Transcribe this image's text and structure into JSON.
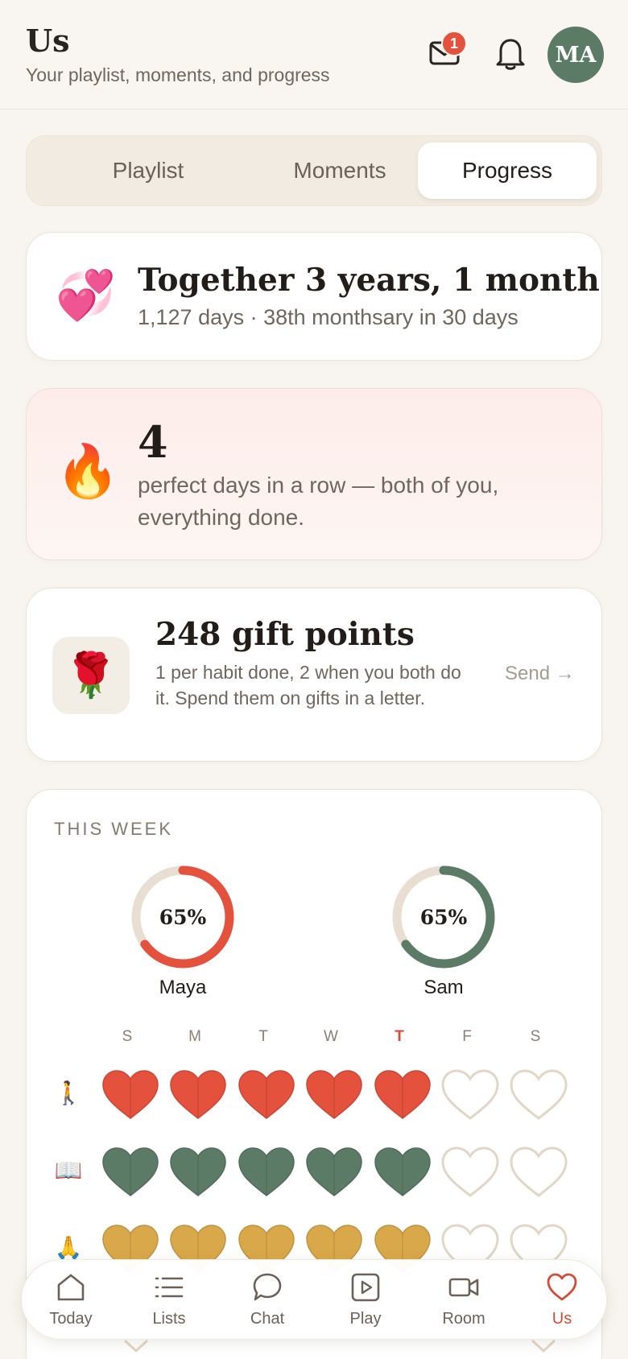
{
  "header": {
    "title": "Us",
    "subtitle": "Your playlist, moments, and progress",
    "mail_badge": "1",
    "avatar_initials": "MA"
  },
  "tabs": [
    {
      "label": "Playlist",
      "active": false
    },
    {
      "label": "Moments",
      "active": false
    },
    {
      "label": "Progress",
      "active": true
    }
  ],
  "together": {
    "emoji": "💞",
    "title": "Together 3 years, 1 month",
    "subtitle": "1,127 days · 38th monthsary in 30 days"
  },
  "streak": {
    "emoji": "🔥",
    "count": "4",
    "description": "perfect days in a row — both of you, everything done."
  },
  "points": {
    "emoji": "🌹",
    "title": "248 gift points",
    "description": "1 per habit done, 2 when you both do it. Spend them on gifts in a letter.",
    "send_label": "Send →"
  },
  "week": {
    "label": "THIS WEEK",
    "people": [
      {
        "name": "Maya",
        "percent_label": "65%",
        "progress": 0.65,
        "color": "#e4513c"
      },
      {
        "name": "Sam",
        "percent_label": "65%",
        "progress": 0.65,
        "color": "#5c7b67"
      }
    ],
    "days": [
      "S",
      "M",
      "T",
      "W",
      "T",
      "F",
      "S"
    ],
    "today_index": 4,
    "habits": [
      {
        "icon": "🚶",
        "color": "#e4513c",
        "done": [
          true,
          true,
          true,
          true,
          true,
          false,
          false
        ]
      },
      {
        "icon": "📖",
        "color": "#5c7b67",
        "done": [
          true,
          true,
          true,
          true,
          true,
          false,
          false
        ]
      },
      {
        "icon": "🙏",
        "color": "#d9a84a",
        "done": [
          true,
          true,
          true,
          true,
          true,
          false,
          false
        ]
      }
    ]
  },
  "nav": [
    {
      "label": "Today",
      "icon": "home-icon",
      "active": false
    },
    {
      "label": "Lists",
      "icon": "list-icon",
      "active": false
    },
    {
      "label": "Chat",
      "icon": "chat-bubble-icon",
      "active": false
    },
    {
      "label": "Play",
      "icon": "play-icon",
      "active": false
    },
    {
      "label": "Room",
      "icon": "video-camera-icon",
      "active": false
    },
    {
      "label": "Us",
      "icon": "heart-icon",
      "active": true
    }
  ],
  "colors": {
    "accent_red": "#e4513c",
    "accent_green": "#5c7b67",
    "accent_gold": "#d9a84a",
    "empty_heart": "#e2d6c4"
  }
}
